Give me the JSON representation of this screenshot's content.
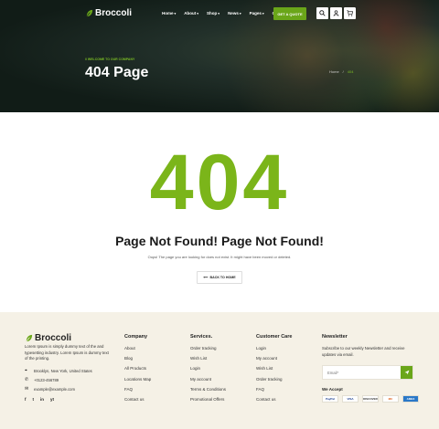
{
  "brand": {
    "name": "Broccoli",
    "accent": "#6aa619"
  },
  "nav": {
    "items": [
      {
        "label": "Home",
        "caret": "▾"
      },
      {
        "label": "About",
        "caret": "▾"
      },
      {
        "label": "Shop",
        "caret": "▾"
      },
      {
        "label": "News",
        "caret": "▾"
      },
      {
        "label": "Pages",
        "caret": "▾"
      },
      {
        "label": "Contact",
        "caret": ""
      }
    ],
    "cta": "GET A QUOTE",
    "icons": [
      "search-icon",
      "user-icon",
      "cart-icon"
    ],
    "cart_count": "0"
  },
  "hero": {
    "welcome": "// WELCOME TO OUR COMPANY",
    "title": "404 Page",
    "breadcrumb": {
      "home": "Home",
      "sep": "/",
      "current": "404"
    }
  },
  "error": {
    "code": "404",
    "heading": "Page Not Found! Page Not Found!",
    "description": "Oops! The page you are looking for does not exist. It might have been moved or deleted.",
    "back_button": "BACK TO HOME"
  },
  "footer": {
    "about": "Lorem Ipsum is simply dummy text of the and typesetting industry. Lorem Ipsum is dummy text of the printing.",
    "address": "Brooklyn, New York, United States",
    "phone": "+0123-456789",
    "email": "example@example.com",
    "social": [
      "f",
      "t",
      "in",
      "yt"
    ],
    "company": {
      "title": "Company",
      "items": [
        "About",
        "Blog",
        "All Products",
        "Locations Map",
        "FAQ",
        "Contact us"
      ]
    },
    "services": {
      "title": "Services.",
      "items": [
        "Order tracking",
        "Wish List",
        "Login",
        "My account",
        "Terms & Conditions",
        "Promotional Offers"
      ]
    },
    "customer": {
      "title": "Customer Care",
      "items": [
        "Login",
        "My account",
        "Wish List",
        "Order tracking",
        "FAQ",
        "Contact us"
      ]
    },
    "newsletter": {
      "title": "Newsletter",
      "text": "Subscribe to our weekly Newsletter and receive updates via email.",
      "placeholder": "Email*",
      "accept": "We Accept",
      "payments": [
        "PayPal",
        "VISA",
        "DISCOVER",
        "MC",
        "AMEX"
      ]
    }
  }
}
